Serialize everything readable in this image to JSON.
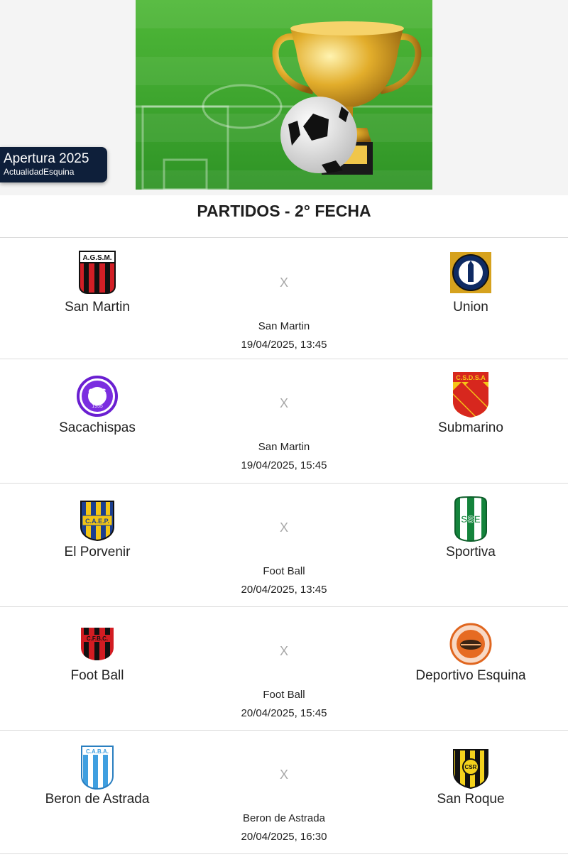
{
  "banner": {
    "badge_title": "Apertura 2025",
    "badge_subtitle": "ActualidadEsquina"
  },
  "section_title": "PARTIDOS - 2° FECHA",
  "separator": "X",
  "matches": [
    {
      "home": "San Martin",
      "away": "Union",
      "venue": "San Martin",
      "datetime": "19/04/2025, 13:45"
    },
    {
      "home": "Sacachispas",
      "away": "Submarino",
      "venue": "San Martin",
      "datetime": "19/04/2025, 15:45"
    },
    {
      "home": "El Porvenir",
      "away": "Sportiva",
      "venue": "Foot Ball",
      "datetime": "20/04/2025, 13:45"
    },
    {
      "home": "Foot Ball",
      "away": "Deportivo Esquina",
      "venue": "Foot Ball",
      "datetime": "20/04/2025, 15:45"
    },
    {
      "home": "Beron de Astrada",
      "away": "San Roque",
      "venue": "Beron de Astrada",
      "datetime": "20/04/2025, 16:30"
    }
  ],
  "crest_text": {
    "san_martin": "A.G.S.M.",
    "sacachispas_top": "CAS",
    "sacachispas_year": "1955",
    "submarino": "C.S.D.S.A",
    "el_porvenir": "C.A.E.P.",
    "sportiva": "SSE",
    "foot_ball": "C.F.B.C.",
    "beron": "C.A.B.A.",
    "san_roque": "CSR"
  },
  "colors": {
    "badge_bg": "#0e1f3a",
    "field_green": "#3aa52c",
    "trophy_gold": "#d9a521",
    "muted_separator": "#a8a8a8"
  }
}
